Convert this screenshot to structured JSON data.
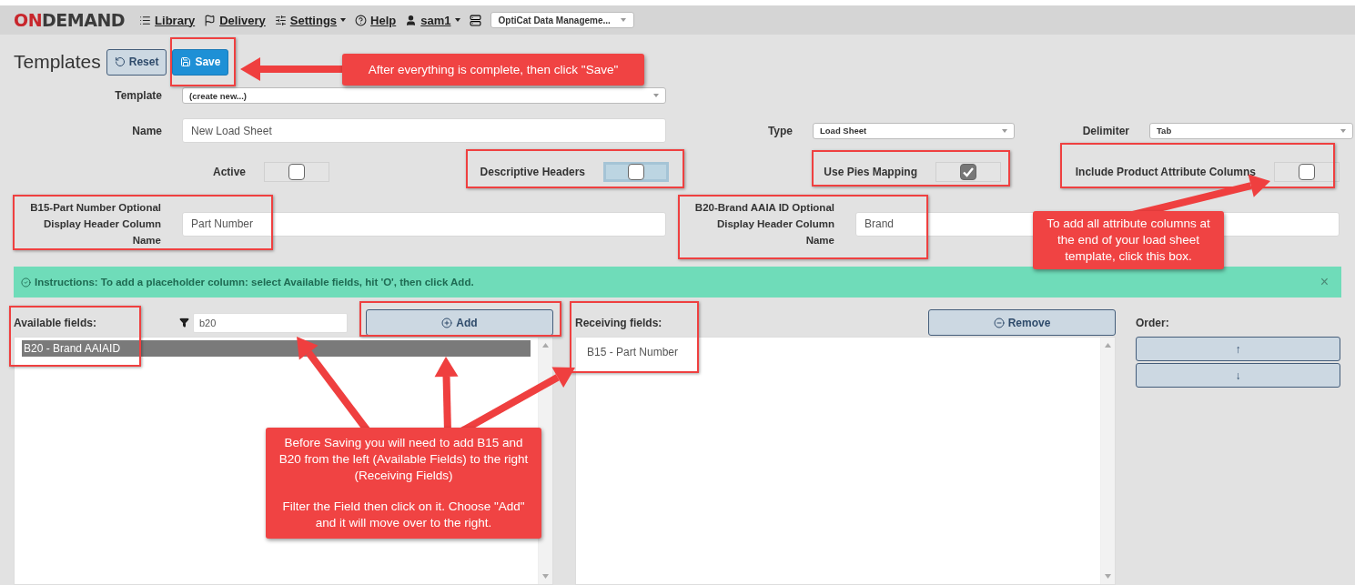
{
  "nav": {
    "brand": {
      "accent": "ON",
      "rest": "DEMAND"
    },
    "links": [
      {
        "label": "Library",
        "kind": "library",
        "dropdown": false
      },
      {
        "label": "Delivery",
        "kind": "delivery",
        "dropdown": false
      },
      {
        "label": "Settings",
        "kind": "settings",
        "dropdown": true
      },
      {
        "label": "Help",
        "kind": "help",
        "dropdown": false
      },
      {
        "label": "sam1",
        "kind": "user",
        "dropdown": true
      }
    ],
    "catalog_select": "OptiCat Data Manageme..."
  },
  "header": {
    "title": "Templates",
    "buttons": [
      {
        "label": "Reset",
        "kind": "reset"
      },
      {
        "label": "Save",
        "kind": "save"
      }
    ]
  },
  "form": {
    "template": {
      "label": "Template",
      "value": "(create new...)"
    },
    "name": {
      "label": "Name",
      "value": "New Load Sheet"
    },
    "type": {
      "label": "Type",
      "value": "Load Sheet"
    },
    "delimiter": {
      "label": "Delimiter",
      "value": "Tab"
    },
    "toggles": [
      {
        "label": "Active",
        "checked": false,
        "focused": false
      },
      {
        "label": "Descriptive Headers",
        "checked": false,
        "focused": true
      },
      {
        "label": "Use Pies Mapping",
        "checked": true,
        "focused": false
      },
      {
        "label": "Include Product Attribute Columns",
        "checked": false,
        "focused": false
      }
    ],
    "header_names": [
      {
        "label": "B15-Part Number Optional Display Header Column Name",
        "value": "Part Number"
      },
      {
        "label": "B20-Brand AAIA ID Optional Display Header Column Name",
        "value": "Brand"
      }
    ]
  },
  "instructions": {
    "text": "Instructions: To add a placeholder column: select Available fields, hit 'O', then click Add.",
    "close": "×"
  },
  "available": {
    "label": "Available fields:",
    "filter": "b20",
    "button": "Add",
    "items": [
      {
        "label": "B20 - Brand AAIAID",
        "selected": true
      }
    ]
  },
  "receiving": {
    "label": "Receiving fields:",
    "button": "Remove",
    "items": [
      {
        "label": "B15 - Part Number",
        "selected": false
      }
    ]
  },
  "order": {
    "label": "Order:",
    "buttons": [
      "↑",
      "↓"
    ]
  },
  "annotations": {
    "callouts": [
      {
        "paragraphs": [
          "After everything is complete, then click \"Save\""
        ]
      },
      {
        "paragraphs": [
          "To add all attribute columns at the end of your load sheet template, click this box."
        ]
      },
      {
        "paragraphs": [
          "Before Saving you will need to add B15 and B20 from the left (Available Fields) to the right (Receiving Fields)",
          "Filter the Field then click on it.  Choose \"Add\" and it will move over to the right."
        ]
      }
    ]
  }
}
